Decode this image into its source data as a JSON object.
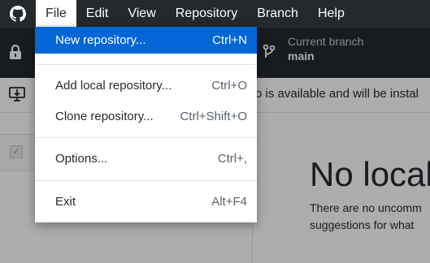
{
  "menubar": {
    "items": [
      {
        "label": "File"
      },
      {
        "label": "Edit"
      },
      {
        "label": "View"
      },
      {
        "label": "Repository"
      },
      {
        "label": "Branch"
      },
      {
        "label": "Help"
      }
    ]
  },
  "toolbar": {
    "branch_label": "Current branch",
    "branch_value": "main"
  },
  "banner": {
    "text": "o is available and will be instal"
  },
  "main": {
    "title": "No local",
    "line1": "There are no uncomm",
    "line2": "suggestions for what"
  },
  "file_menu": {
    "new_repository": {
      "label": "New repository...",
      "shortcut": "Ctrl+N"
    },
    "add_local": {
      "label": "Add local repository...",
      "shortcut": "Ctrl+O"
    },
    "clone": {
      "label": "Clone repository...",
      "shortcut": "Ctrl+Shift+O"
    },
    "options": {
      "label": "Options...",
      "shortcut": "Ctrl+,"
    },
    "exit": {
      "label": "Exit",
      "shortcut": "Alt+F4"
    }
  },
  "colors": {
    "chrome": "#24292e",
    "accent": "#0366d6"
  }
}
